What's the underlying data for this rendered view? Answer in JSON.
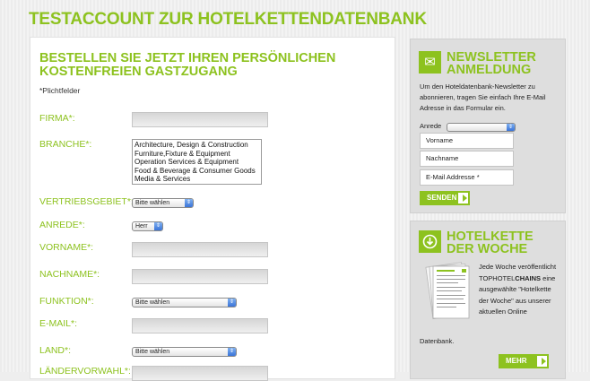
{
  "page": {
    "title": "TESTACCOUNT ZUR HOTELKETTENDATENBANK"
  },
  "form": {
    "heading": "BESTELLEN SIE JETZT IHREN PERSÖNLICHEN KOSTENFREIEN GASTZUGANG",
    "required_note": "*Plichtfelder",
    "labels": {
      "firma": "FIRMA*:",
      "branche": "BRANCHE*:",
      "vertriebsgebiet": "VERTRIEBSGEBIET*:",
      "anrede": "ANREDE*:",
      "vorname": "VORNAME*:",
      "nachname": "NACHNAME*:",
      "funktion": "FUNKTION*:",
      "email": "E-MAIL*:",
      "land": "LAND*:",
      "laendervorwahl": "LÄNDERVORWAHL*:"
    },
    "branche_options": [
      "Architecture, Design & Construction",
      "Furniture,Fixture & Equipment",
      "Operation Services & Equipment",
      "Food & Beverage & Consumer Goods",
      "Media & Services"
    ],
    "selects": {
      "vertriebsgebiet": "Bitte wählen",
      "anrede": "Herr",
      "funktion": "Bitte wählen",
      "land": "Bitte wählen"
    }
  },
  "newsletter": {
    "title_line1": "NEWSLETTER",
    "title_line2": "ANMELDUNG",
    "description": "Um den Hoteldatenbank-Newsletter zu abonnieren, tragen Sie einfach Ihre E-Mail Adresse in das Formular ein.",
    "anrede_label": "Anrede",
    "vorname_placeholder": "Vorname",
    "nachname_placeholder": "Nachname",
    "email_placeholder": "E-Mail Addresse *",
    "submit_label": "SENDEN"
  },
  "hotelkette": {
    "title_line1": "HOTELKETTE",
    "title_line2": "DER WOCHE",
    "text_part1": "Jede Woche veröffentlicht TOPHOTEL",
    "text_bold": "CHAINS",
    "text_part2": " eine ausgewählte \"Hotelkette der Woche\" aus unserer aktuellen Online",
    "text_last": "Datenbank.",
    "more_label": "MEHR"
  },
  "colors": {
    "accent": "#8dc21f"
  }
}
